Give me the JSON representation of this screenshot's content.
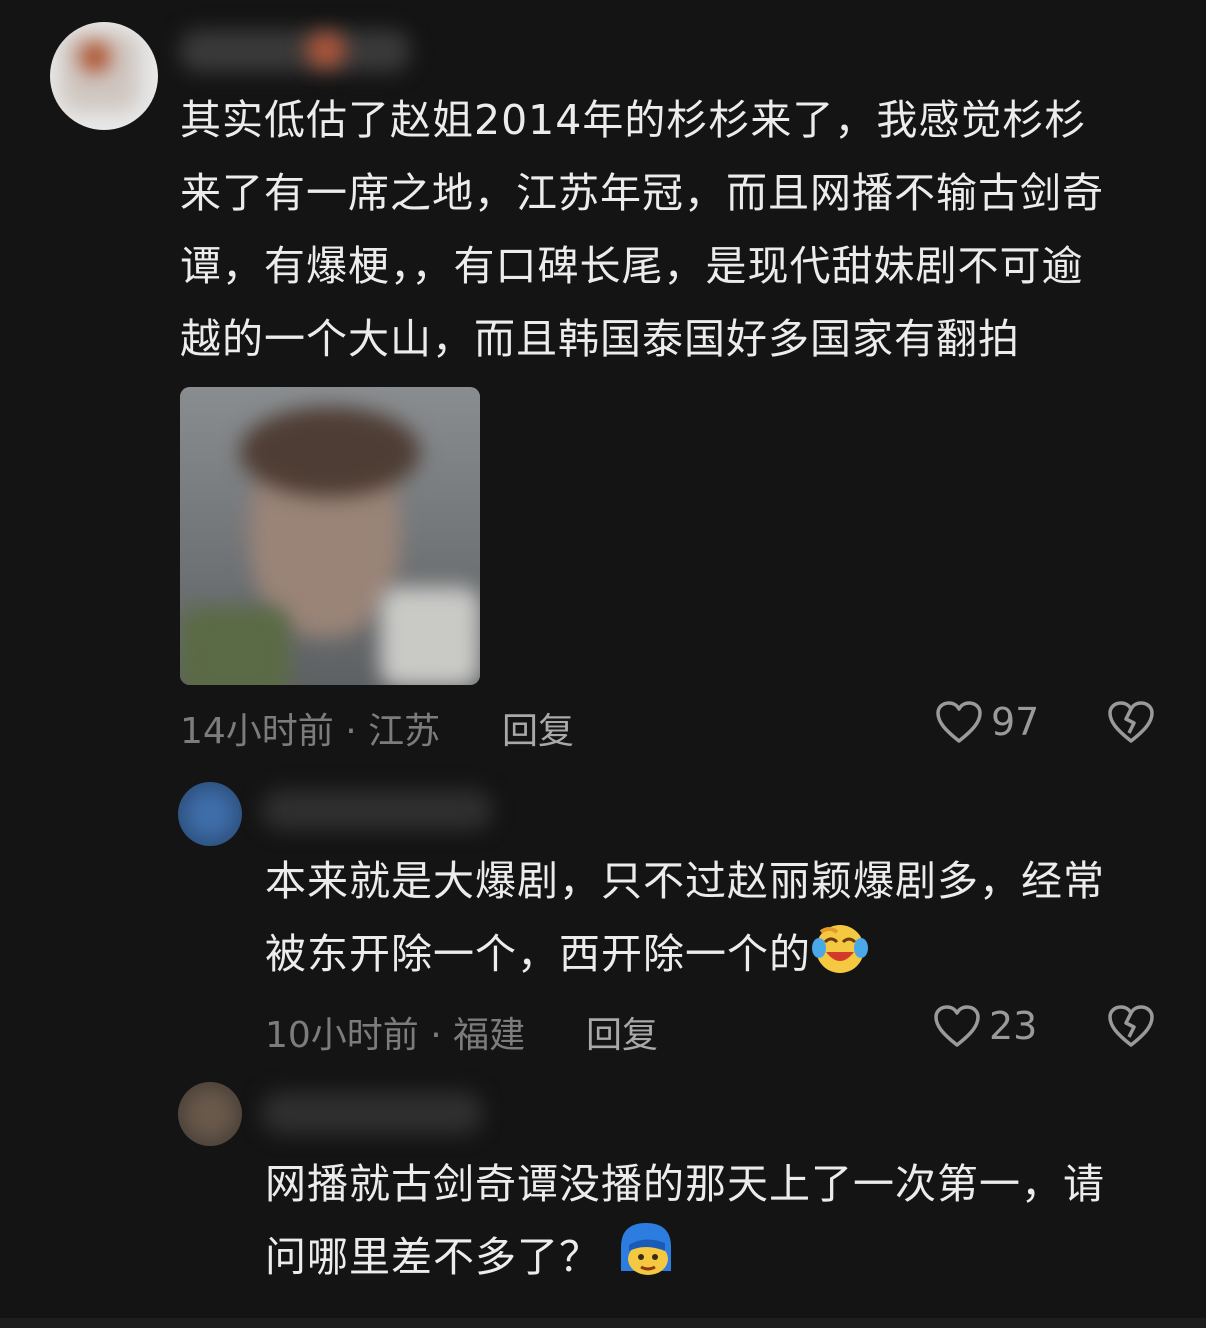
{
  "comment1": {
    "text": "其实低估了赵姐2014年的杉杉来了，我感觉杉杉\n来了有一席之地，江苏年冠，而且网播不输古剑奇\n谭，有爆梗，，有口碑长尾，是现代甜妹剧不可逾\n越的一个大山，而且韩国泰国好多国家有翻拍",
    "time_location": "14小时前 · 江苏",
    "reply_label": "回复",
    "likes": "97"
  },
  "reply1": {
    "text": "本来就是大爆剧，只不过赵丽颖爆剧多，经常\n被东开除一个，西开除一个的",
    "emoji": "laughing-crying-emoji",
    "time_location": "10小时前 · 福建",
    "reply_label": "回复",
    "likes": "23"
  },
  "reply2": {
    "text": "网播就古剑奇谭没播的那天上了一次第一，请\n问哪里差不多了？",
    "emoji": "blue-hair-face-emoji"
  },
  "icons": {
    "like": "heart-outline-icon",
    "dislike": "broken-heart-icon"
  },
  "colors": {
    "background": "#141414",
    "text": "#ececec",
    "meta": "#7c7c7c"
  }
}
